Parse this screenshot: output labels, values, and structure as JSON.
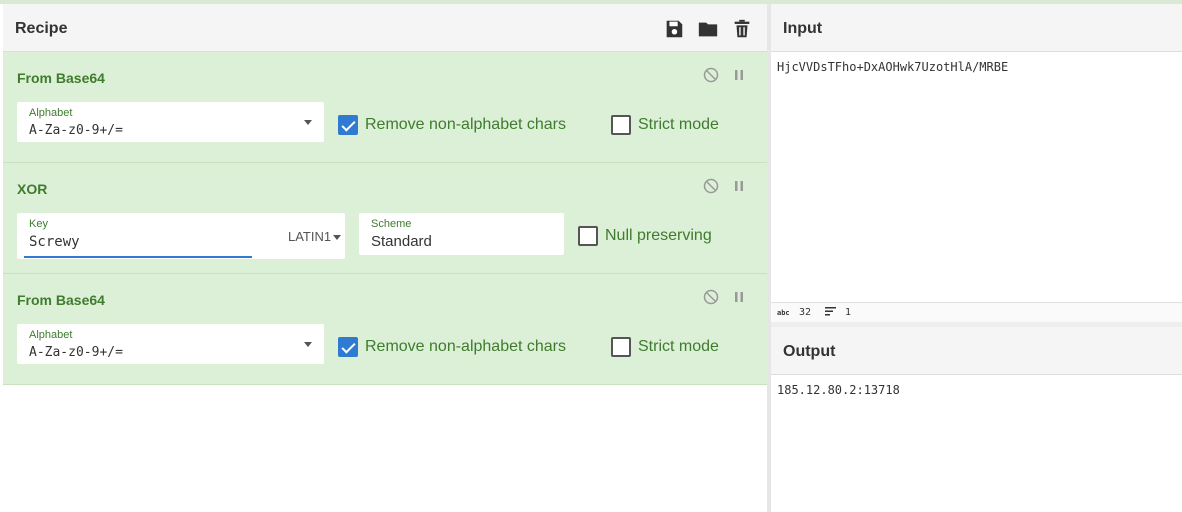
{
  "recipe": {
    "title": "Recipe",
    "icons": [
      "save-icon",
      "folder-icon",
      "trash-icon"
    ],
    "operations": [
      {
        "title": "From Base64",
        "alphabet_label": "Alphabet",
        "alphabet_value": "A-Za-z0-9+/=",
        "remove_label": "Remove non-alphabet chars",
        "remove_checked": true,
        "strict_label": "Strict mode",
        "strict_checked": false
      },
      {
        "title": "XOR",
        "key_label": "Key",
        "key_value": "Screwy",
        "key_encoding": "LATIN1",
        "scheme_label": "Scheme",
        "scheme_value": "Standard",
        "null_label": "Null preserving",
        "null_checked": false
      },
      {
        "title": "From Base64",
        "alphabet_label": "Alphabet",
        "alphabet_value": "A-Za-z0-9+/=",
        "remove_label": "Remove non-alphabet chars",
        "remove_checked": true,
        "strict_label": "Strict mode",
        "strict_checked": false
      }
    ]
  },
  "input": {
    "title": "Input",
    "text": "HjcVVDsTFho+DxAOHwk7UzotHlA/MRBE",
    "length": "32",
    "lines": "1"
  },
  "output": {
    "title": "Output",
    "text": "185.12.80.2:13718"
  },
  "colors": {
    "accent_green": "#3f7c2d",
    "op_background": "#dcefd7",
    "checkbox_blue": "#2f7bd1"
  }
}
